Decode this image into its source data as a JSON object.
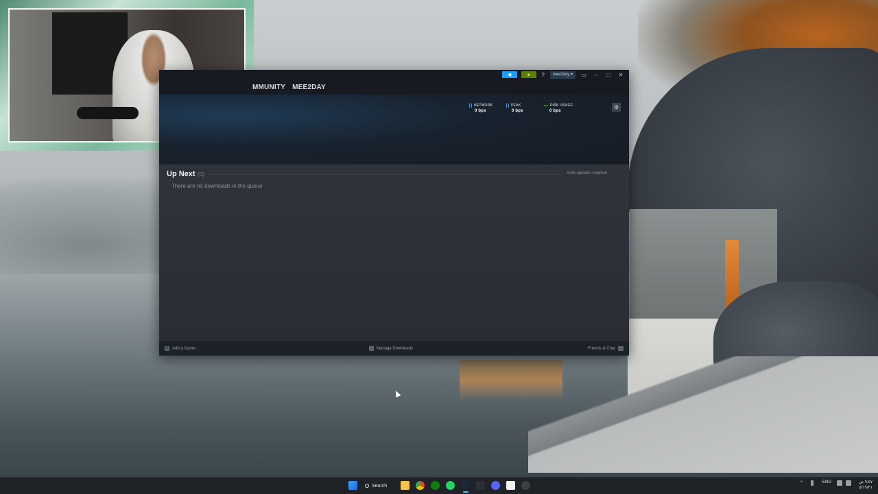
{
  "steam": {
    "nav": [
      "MMUNITY",
      "MEE2DAY"
    ],
    "account": "mee2day",
    "titlebar": {
      "announce_icon": "megaphone-icon",
      "notify_icon": "bell-icon",
      "help": "?"
    },
    "stats": {
      "network": {
        "label": "NETWORK",
        "value": "0 bps"
      },
      "peak": {
        "label": "PEAK",
        "value": "0 bps"
      },
      "disk": {
        "label": "DISK USAGE",
        "value": "0 bps"
      }
    },
    "up_next": {
      "title": "Up Next",
      "count": "(0)",
      "auto_updates": "Auto-updates enabled",
      "empty_message": "There are no downloads in the queue"
    },
    "footer": {
      "add_game": "Add a Game",
      "manage_downloads": "Manage Downloads",
      "friends_chat": "Friends & Chat"
    }
  },
  "taskbar": {
    "search_label": "Search",
    "lang": "ENG",
    "time": "٩:٤٧ ص",
    "date": "٥/١٩/٢١"
  },
  "colors": {
    "steam_blue": "#1a9fff",
    "steam_green": "#5c7e10",
    "disk_green": "#6dc245"
  }
}
